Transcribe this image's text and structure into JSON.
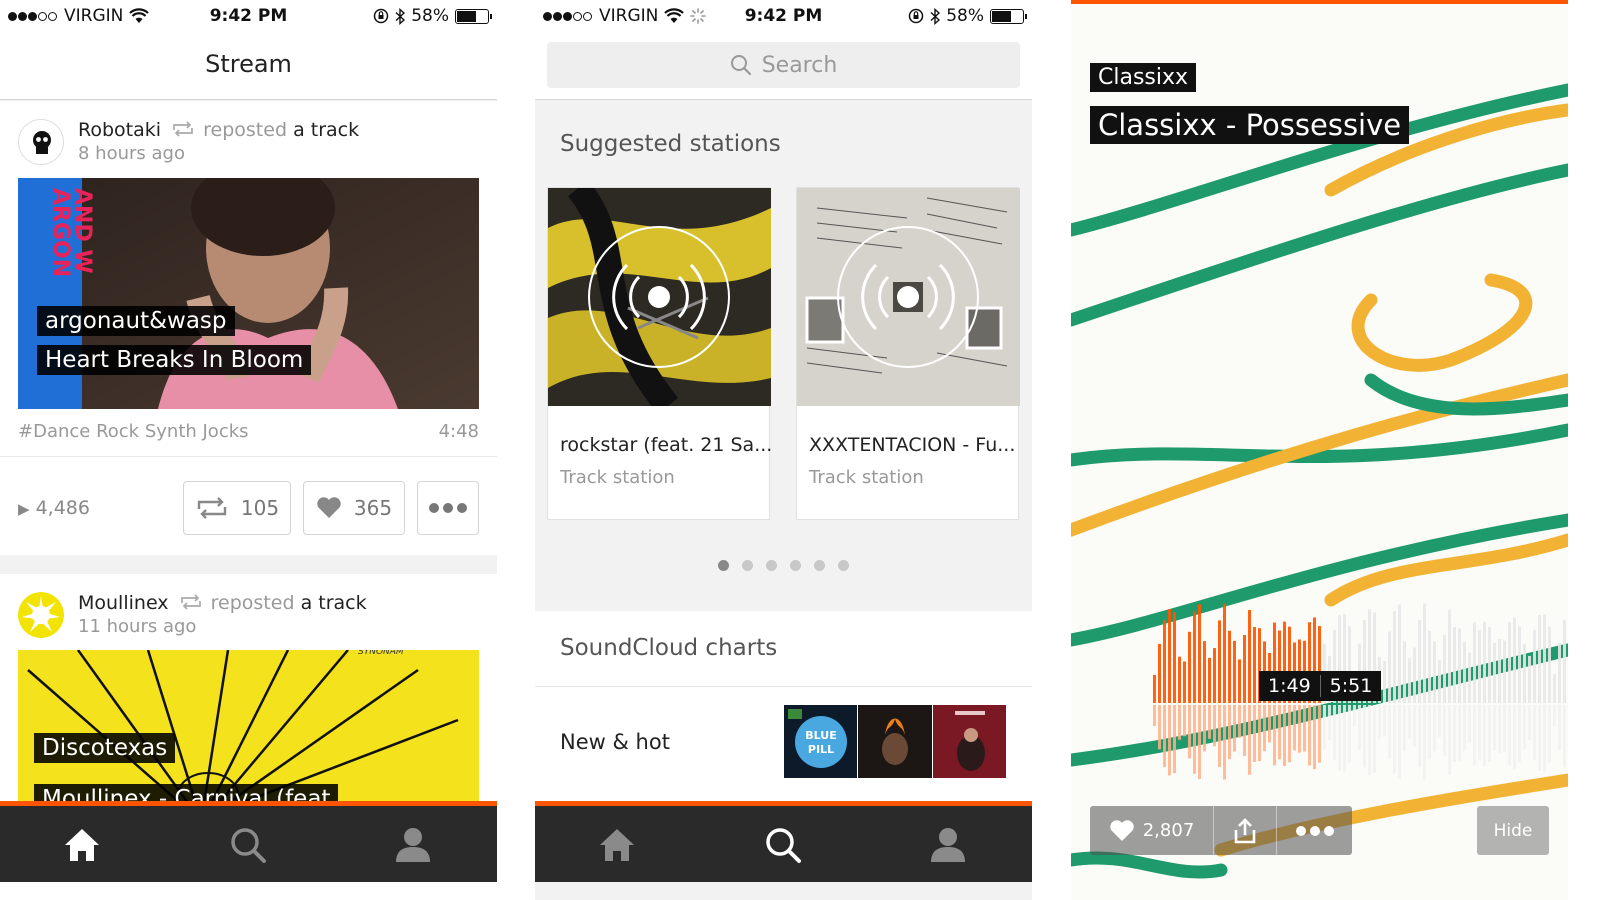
{
  "status_bar": {
    "carrier": "VIRGIN",
    "time": "9:42 PM",
    "battery_pct": "58%",
    "battery_level": 0.58
  },
  "stream_screen": {
    "title": "Stream",
    "posts": [
      {
        "user": "Robotaki",
        "action": "reposted",
        "object": "a track",
        "time_ago": "8 hours ago",
        "artist": "argonaut&wasp",
        "track": "Heart Breaks In Bloom",
        "tag": "#Dance Rock Synth Jocks",
        "duration": "4:48",
        "plays": "4,486",
        "reposts": "105",
        "likes": "365"
      },
      {
        "user": "Moullinex",
        "action": "reposted",
        "object": "a track",
        "time_ago": "11 hours ago",
        "artist": "Discotexas",
        "track": "Moullinex - Carnival (feat"
      }
    ]
  },
  "search_screen": {
    "search_placeholder": "Search",
    "suggested_title": "Suggested stations",
    "stations": [
      {
        "name": "rockstar (feat. 21 Sa...",
        "type": "Track station"
      },
      {
        "name": "XXXTENTACION - Fu...",
        "type": "Track station"
      }
    ],
    "page_count": 6,
    "active_page": 1,
    "charts_title": "SoundCloud charts",
    "charts_row_label": "New & hot"
  },
  "player_screen": {
    "artist": "Classixx",
    "title": "Classixx - Possessive",
    "elapsed": "1:49",
    "total": "5:51",
    "progress": 0.31,
    "likes": "2,807",
    "hide_label": "Hide"
  },
  "tabbar_icons": [
    "home-icon",
    "search-icon",
    "profile-icon"
  ],
  "colors": {
    "accent": "#ff5500",
    "tabbar_bg": "#2a2a2a",
    "tab_active": "#ffffff",
    "tab_inactive": "#8a8a8a"
  }
}
